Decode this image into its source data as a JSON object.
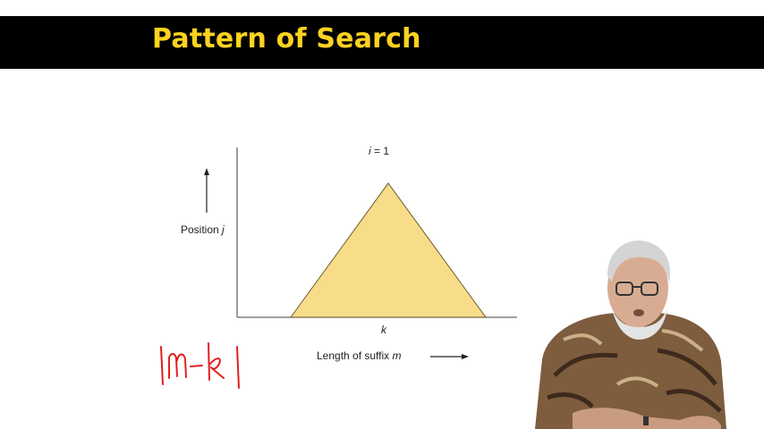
{
  "slide": {
    "title": "Pattern of Search",
    "colors": {
      "title_bar": "#000000",
      "title_text": "#ffd21f",
      "triangle_fill": "#f7dc8a",
      "ink_red": "#e02020"
    }
  },
  "diagram": {
    "top_label_var": "i",
    "top_label_rest": " = 1",
    "y_axis_label_text": "Position ",
    "y_axis_label_var": "j",
    "x_tick_label": "k",
    "x_axis_label_text": "Length of suffix ",
    "x_axis_label_var": "m",
    "shape": "triangle"
  },
  "annotation": {
    "handwritten": "|m-k|"
  },
  "presenter": {
    "description": "video inset of lecturer"
  }
}
